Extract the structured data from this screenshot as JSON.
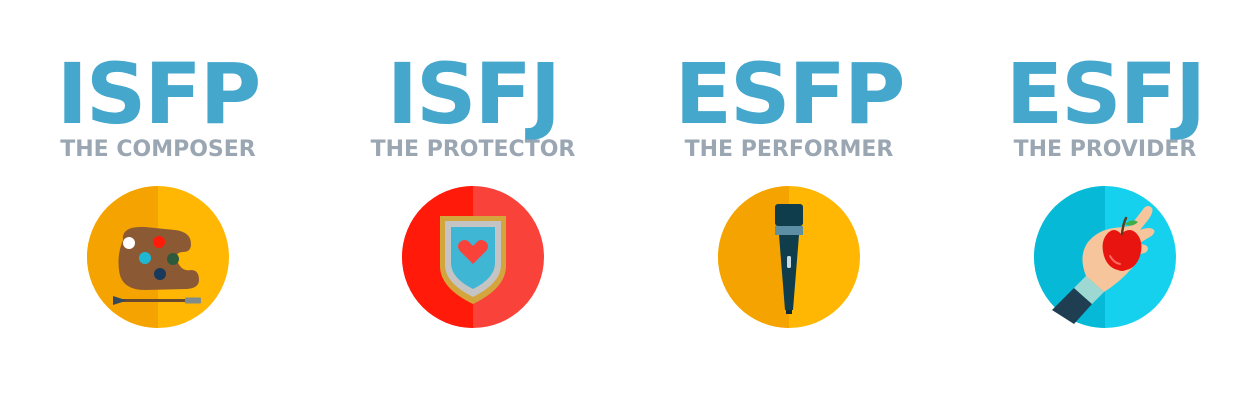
{
  "types": [
    {
      "code": "ISFP",
      "nickname": "THE COMPOSER",
      "icon": "paint-palette-icon",
      "colors": {
        "circle_light": "#ffb703",
        "circle_dark": "#f5a300"
      }
    },
    {
      "code": "ISFJ",
      "nickname": "THE PROTECTOR",
      "icon": "heart-shield-icon",
      "colors": {
        "circle_light": "#f9423a",
        "circle_dark": "#ff1a0a"
      }
    },
    {
      "code": "ESFP",
      "nickname": "THE PERFORMER",
      "icon": "microphone-icon",
      "colors": {
        "circle_light": "#ffb703",
        "circle_dark": "#f5a300"
      }
    },
    {
      "code": "ESFJ",
      "nickname": "THE PROVIDER",
      "icon": "hand-apple-icon",
      "colors": {
        "circle_light": "#16d1ee",
        "circle_dark": "#06b9d6"
      }
    }
  ],
  "theme": {
    "code_color": "#45a7cc",
    "nickname_color": "#9aa6b2",
    "background": "#ffffff"
  }
}
